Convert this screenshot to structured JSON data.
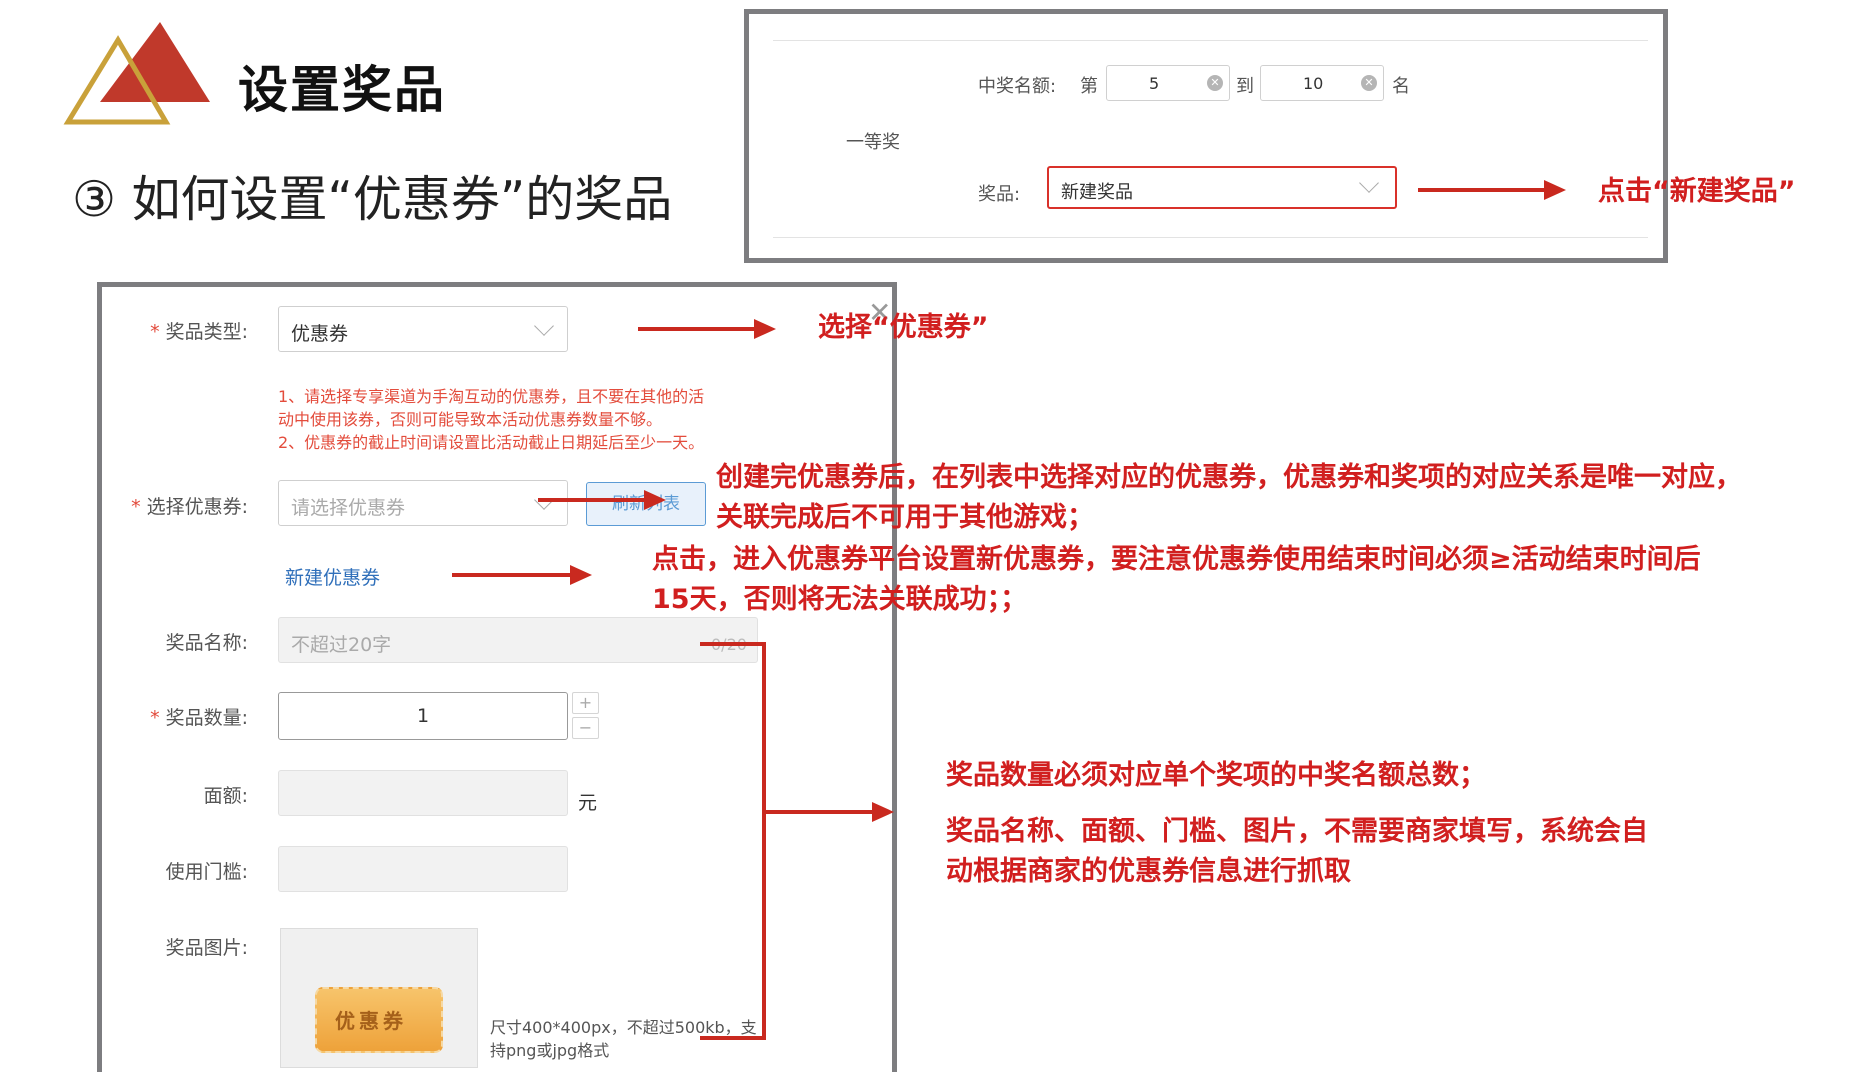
{
  "slide": {
    "title": "设置奖品",
    "subtitle": "③ 如何设置“优惠券”的奖品"
  },
  "rank_panel": {
    "count_label": "中奖名额:",
    "from_label": "第",
    "from_value": "5",
    "to_label": "到",
    "to_value": "10",
    "unit_label": "名",
    "tier_label": "一等奖",
    "prize_label": "奖品:",
    "prize_select_value": "新建奖品"
  },
  "form": {
    "prize_type_label": "奖品类型:",
    "prize_type_value": "优惠券",
    "notice_line1": "1、请选择专享渠道为手淘互动的优惠券，且不要在其他的活",
    "notice_line2": "动中使用该券，否则可能导致本活动优惠券数量不够。",
    "notice_line3": "2、优惠券的截止时间请设置比活动截止日期延后至少一天。",
    "coupon_label": "选择优惠券:",
    "coupon_placeholder": "请选择优惠券",
    "refresh_button": "刷新列表",
    "new_coupon_link": "新建优惠券",
    "name_label": "奖品名称:",
    "name_placeholder": "不超过20字",
    "name_counter": "0/20",
    "quantity_label": "奖品数量:",
    "quantity_value": "1",
    "face_value_label": "面额:",
    "face_value_unit": "元",
    "threshold_label": "使用门槛:",
    "image_label": "奖品图片:",
    "image_coupon_text": "优惠券",
    "image_hint_line1": "尺寸400*400px，不超过500kb，支",
    "image_hint_line2": "持png或jpg格式"
  },
  "annotations": {
    "click_new_prize": "点击“新建奖品”",
    "select_coupon": "选择“优惠券”",
    "coupon_note_line1": "创建完优惠券后，在列表中选择对应的优惠券，优惠券和奖项的对应关系是唯一对应，",
    "coupon_note_line2": "关联完成后不可用于其他游戏；",
    "new_coupon_note_line1": "点击，进入优惠券平台设置新优惠券，要注意优惠券使用结束时间必须≥活动结束时间后",
    "new_coupon_note_line2": "15天，否则将无法关联成功；；",
    "quantity_note": "奖品数量必须对应单个奖项的中奖名额总数；",
    "auto_fill_note_line1": "奖品名称、面额、门槛、图片，不需要商家填写，系统会自",
    "auto_fill_note_line2": "动根据商家的优惠券信息进行抓取"
  },
  "colors": {
    "accent_red": "#d11f1f",
    "logo_red": "#c0392b",
    "logo_gold": "#c9a13a",
    "panel_border": "#7d7d80",
    "link_blue": "#2f6fba"
  }
}
